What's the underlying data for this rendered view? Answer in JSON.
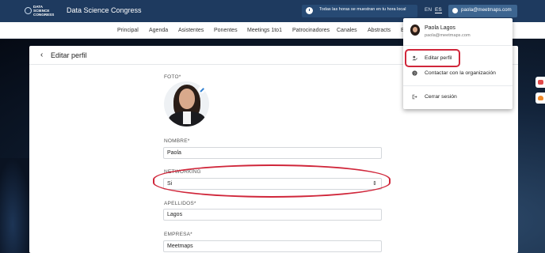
{
  "header": {
    "logo_text": "DATA SCIENCE CONGRESS",
    "brand_title": "Data Science Congress",
    "timezone_note": "Todas las horas se muestran en tu hora local",
    "languages": [
      "EN",
      "ES"
    ],
    "active_language": "ES",
    "user_email": "paola@meetmaps.com",
    "icons": {
      "timezone": "info-icon",
      "user": "user-circle-icon"
    }
  },
  "nav": {
    "items": [
      "Principal",
      "Agenda",
      "Asistentes",
      "Ponentes",
      "Meetings 1to1",
      "Patrocinadores",
      "Canales",
      "Abstracts",
      "E"
    ]
  },
  "card": {
    "title": "Editar perfil",
    "back_icon": "chevron-left-icon"
  },
  "form": {
    "photo_label": "FOTO*",
    "nombre_label": "NOMBRE*",
    "nombre_value": "Paola",
    "networking_label": "NETWORKING",
    "networking_value": "Si",
    "apellidos_label": "APELLIDOS*",
    "apellidos_value": "Lagos",
    "empresa_label": "EMPRESA*",
    "empresa_value": "Meetmaps"
  },
  "menu": {
    "user_name": "Paola Lagos",
    "user_email": "paola@meetmaps.com",
    "items": [
      {
        "label": "Editar perfil",
        "icon": "user-edit-icon"
      },
      {
        "label": "Contactar con la organización",
        "icon": "help-icon"
      },
      {
        "label": "Cerrar sesión",
        "icon": "logout-icon"
      }
    ]
  },
  "colors": {
    "header_bg": "#1e3a5f",
    "highlight": "#d0263a",
    "accent": "#2f7fd1"
  }
}
